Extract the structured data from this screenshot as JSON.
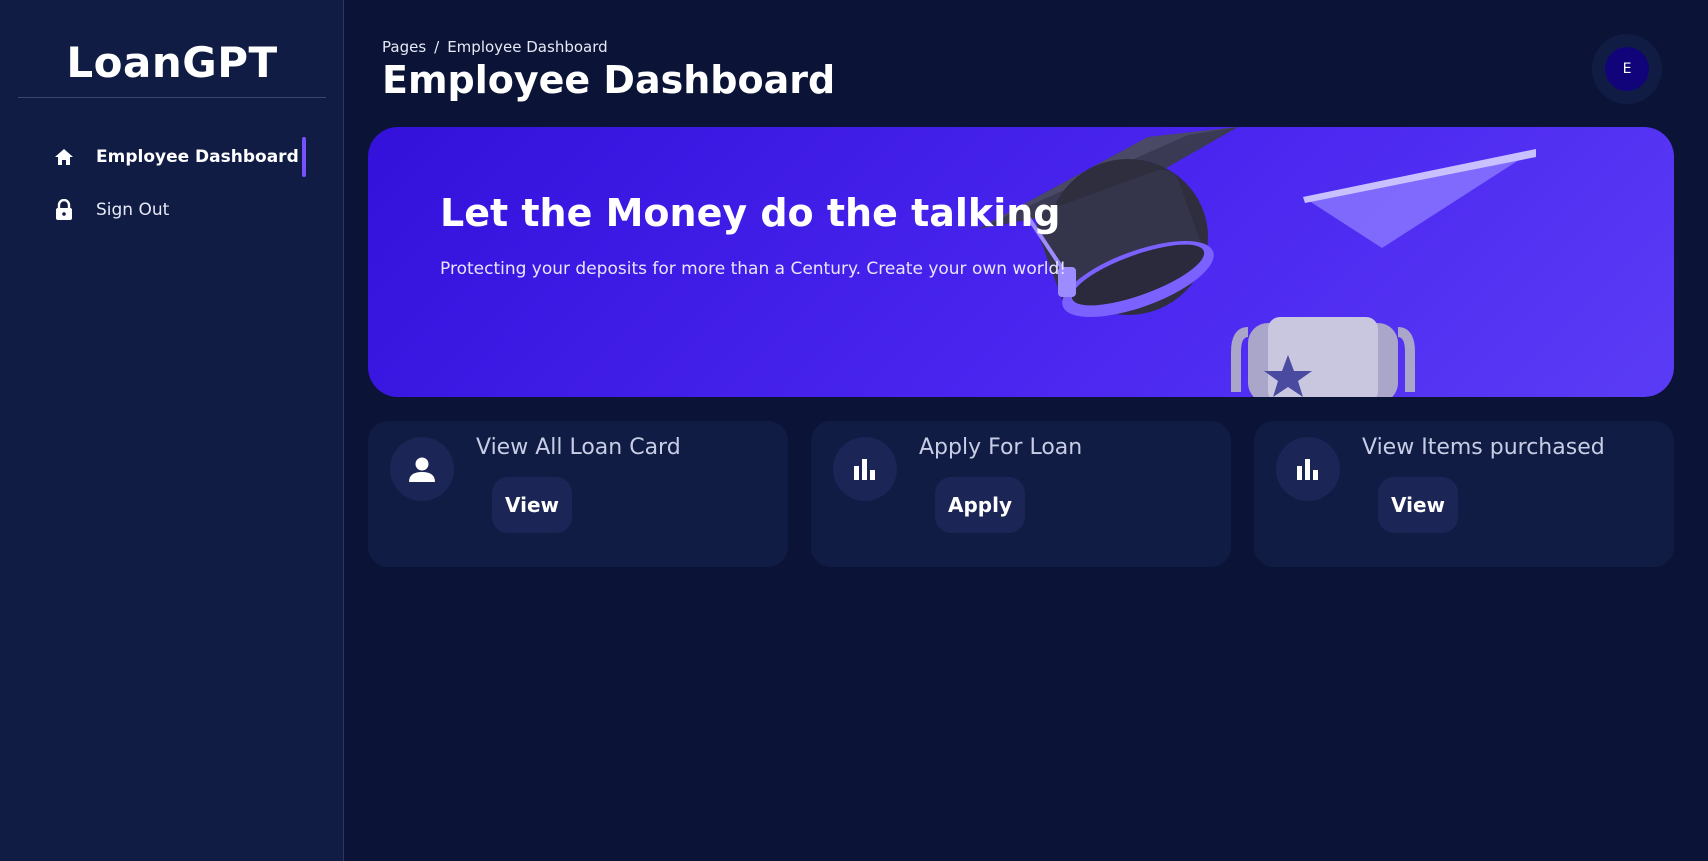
{
  "app": {
    "title": "LoanGPT"
  },
  "sidebar": {
    "items": [
      {
        "label": "Employee Dashboard",
        "icon": "home-icon",
        "active": true
      },
      {
        "label": "Sign Out",
        "icon": "lock-icon",
        "active": false
      }
    ]
  },
  "header": {
    "breadcrumb": {
      "root": "Pages",
      "separator": "/",
      "current": "Employee Dashboard"
    },
    "title": "Employee Dashboard",
    "avatar_initial": "E"
  },
  "banner": {
    "title": "Let the Money do the talking",
    "subtitle": "Protecting your deposits for more than a Century. Create your own world!"
  },
  "cards": [
    {
      "title": "View All Loan Card",
      "button": "View",
      "icon": "person-icon"
    },
    {
      "title": "Apply For Loan",
      "button": "Apply",
      "icon": "bar-chart-icon"
    },
    {
      "title": "View Items purchased",
      "button": "View",
      "icon": "bar-chart-icon"
    }
  ],
  "colors": {
    "background": "#0b1437",
    "sidebar": "#111c44",
    "accent": "#7551ff",
    "banner": "#3311db",
    "avatar": "#11047a"
  }
}
